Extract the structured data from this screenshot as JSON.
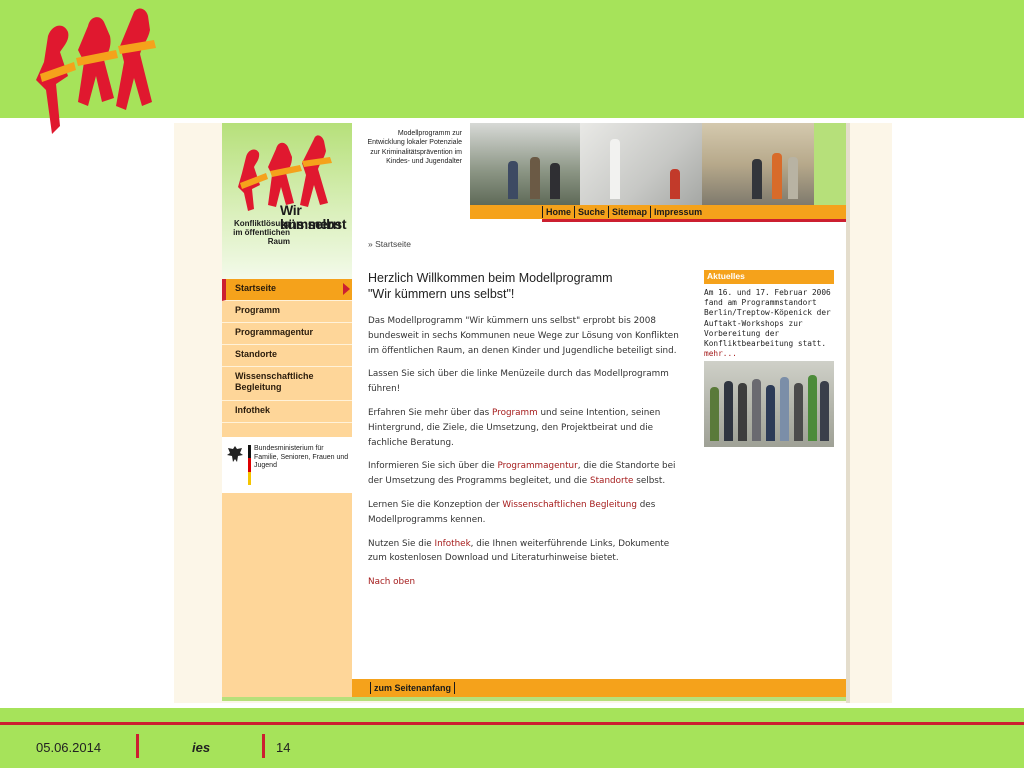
{
  "site": {
    "title_line1": "Wir kümmern",
    "title_line2": "uns selbst",
    "subtitle": "Konfliktlösung im öffentlichen Raum",
    "tagline": "Modellprogramm zur Entwicklung lokaler Potenziale zur Kriminalitätsprävention im Kindes- und Jugendalter"
  },
  "topnav": [
    "Home",
    "Suche",
    "Sitemap",
    "Impressum"
  ],
  "breadcrumb": "» Startseite",
  "leftnav": {
    "items": [
      {
        "label": "Startseite",
        "active": true
      },
      {
        "label": "Programm"
      },
      {
        "label": "Programmagentur"
      },
      {
        "label": "Standorte"
      },
      {
        "label": "Wissenschaftliche Begleitung"
      },
      {
        "label": "Infothek"
      }
    ],
    "ministry": "Bundesministerium für Familie, Senioren, Frauen und Jugend"
  },
  "main": {
    "heading_line1": "Herzlich Willkommen beim Modellprogramm",
    "heading_line2": "\"Wir kümmern uns selbst\"!",
    "p1": "Das Modellprogramm \"Wir kümmern uns selbst\" erprobt bis 2008 bundesweit in sechs Kommunen neue Wege zur Lösung von Konflikten im öffentlichen Raum, an denen Kinder und Jugendliche beteiligt sind.",
    "p2": "Lassen Sie sich über die linke Menüzeile durch das Modellprogramm führen!",
    "p3_a": "Erfahren Sie mehr über das ",
    "p3_link": "Programm",
    "p3_b": " und seine Intention, seinen Hintergrund, die Ziele, die Umsetzung, den Projektbeirat und die fachliche Beratung.",
    "p4_a": "Informieren Sie sich über die ",
    "p4_link1": "Programmagentur",
    "p4_b": ", die die Standorte bei der Umsetzung des Programms begleitet, und die ",
    "p4_link2": "Standorte",
    "p4_c": " selbst.",
    "p5_a": "Lernen Sie die Konzeption der ",
    "p5_link": "Wissenschaftlichen Begleitung",
    "p5_b": " des Modellprogramms kennen.",
    "p6_a": "Nutzen Sie die ",
    "p6_link": "Infothek",
    "p6_b": ", die Ihnen weiterführende Links, Dokumente zum kostenlosen Download und Literaturhinweise bietet.",
    "back_to_top": "Nach oben"
  },
  "news": {
    "title": "Aktuelles",
    "text": "Am 16. und 17. Februar 2006 fand am Programmstandort Berlin/Treptow-Köpenick der Auftakt-Workshops zur Vorbereitung der Konfliktbearbeitung statt. ",
    "more": "mehr..."
  },
  "site_footer": "zum Seitenanfang",
  "slide_footer": {
    "date": "05.06.2014",
    "org": "ies",
    "page": "14"
  },
  "colors": {
    "slide_green": "#a6e35a",
    "brand_red": "#cc1f30",
    "brand_orange": "#f5a21b",
    "nav_bg": "#fed699"
  }
}
